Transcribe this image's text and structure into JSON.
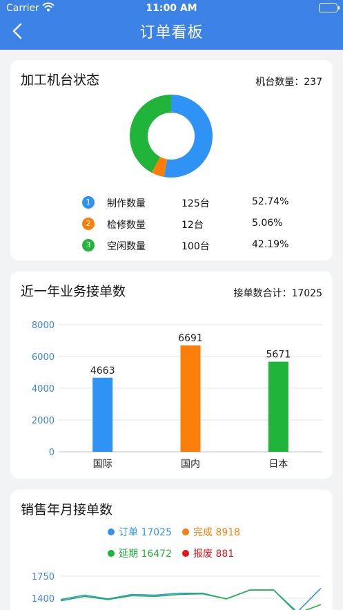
{
  "status_bar": {
    "carrier": "Carrier",
    "time": "11:00 AM"
  },
  "nav": {
    "title": "订单看板"
  },
  "machine_status": {
    "title": "加工机台状态",
    "total_label": "机台数量：237",
    "items": [
      {
        "index": "1",
        "name": "制作数量",
        "count": "125台",
        "percent": "52.74%",
        "value": 125,
        "color": "#2f93f5"
      },
      {
        "index": "2",
        "name": "检修数量",
        "count": "12台",
        "percent": "5.06%",
        "value": 12,
        "color": "#fb7d0a"
      },
      {
        "index": "3",
        "name": "空闲数量",
        "count": "100台",
        "percent": "42.19%",
        "value": 100,
        "color": "#21b43a"
      }
    ]
  },
  "orders_year": {
    "title": "近一年业务接单数",
    "total_label": "接单数合计：17025"
  },
  "sales_month": {
    "title": "销售年月接单数",
    "legend": [
      {
        "label": "订单 17025",
        "color": "#2f93f5"
      },
      {
        "label": "完成 8918",
        "color": "#fb7d0a"
      },
      {
        "label": "延期 16472",
        "color": "#21b43a"
      },
      {
        "label": "报废 881",
        "color": "#e8121a"
      }
    ]
  },
  "chart_data": [
    {
      "type": "pie",
      "categories": [
        "制作数量",
        "检修数量",
        "空闲数量"
      ],
      "values": [
        125,
        12,
        100
      ],
      "colors": [
        "#2f93f5",
        "#fb7d0a",
        "#21b43a"
      ]
    },
    {
      "type": "bar",
      "categories": [
        "国际",
        "国内",
        "日本"
      ],
      "values": [
        4663,
        6691,
        5671
      ],
      "colors": [
        "#2f93f5",
        "#fb7d0a",
        "#21b43a"
      ],
      "ylim": [
        0,
        8000
      ],
      "yticks": [
        0,
        2000,
        4000,
        6000,
        8000
      ],
      "grid": true
    },
    {
      "type": "line",
      "ylim": [
        1200,
        1750
      ],
      "yticks": [
        1400,
        1750
      ],
      "grid": true,
      "series": [
        {
          "name": "订单",
          "color": "#2f93f5",
          "values": [
            1380,
            1450,
            1390,
            1460,
            1450,
            1480,
            1480,
            1390,
            1530,
            1530,
            1180,
            1560
          ]
        },
        {
          "name": "延期",
          "color": "#21b43a",
          "values": [
            1360,
            1430,
            1380,
            1440,
            1430,
            1460,
            1470,
            1390,
            1530,
            1530,
            1160,
            1300
          ]
        }
      ]
    }
  ]
}
